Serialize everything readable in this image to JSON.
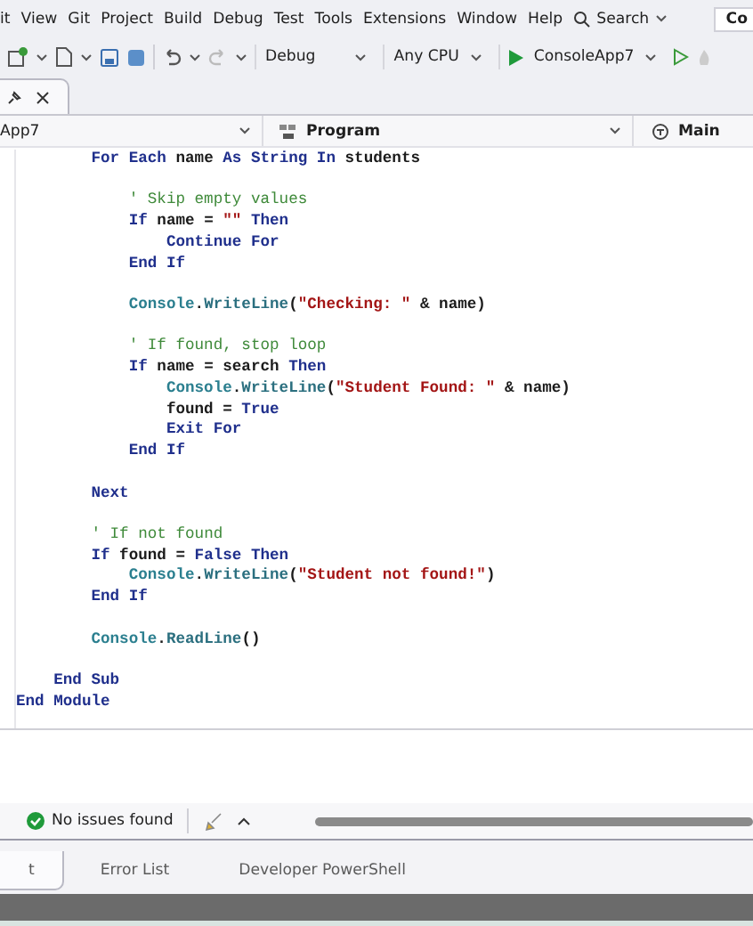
{
  "menu_bar": {
    "items": [
      "it",
      "View",
      "Git",
      "Project",
      "Build",
      "Debug",
      "Test",
      "Tools",
      "Extensions",
      "Window",
      "Help"
    ],
    "search": "Search",
    "account_badge": "Co"
  },
  "toolbar": {
    "configuration": "Debug",
    "platform": "Any CPU",
    "start_target": "ConsoleApp7"
  },
  "document_tab": {
    "selected": true
  },
  "navigation_bar": {
    "project": "App7",
    "class": "Program",
    "member": "Main"
  },
  "code_lines": [
    {
      "kind": "group",
      "children": [
        {
          "kind": "group",
          "children": [
            {
              "kind": "code",
              "tokens": [
                {
                  "kind": "keyword",
                  "text": "For Each"
                },
                {
                  "kind": "plain",
                  "text": " name "
                },
                {
                  "kind": "keyword",
                  "text": "As String In"
                },
                {
                  "kind": "plain",
                  "text": " students"
                }
              ],
              "children": [
                {
                  "kind": "blank"
                },
                {
                  "kind": "code",
                  "tokens": [
                    {
                      "kind": "comment",
                      "text": "' Skip empty values"
                    }
                  ]
                },
                {
                  "kind": "code",
                  "tokens": [
                    {
                      "kind": "keyword",
                      "text": "If"
                    },
                    {
                      "kind": "plain",
                      "text": " name = "
                    },
                    {
                      "kind": "string",
                      "text": "\"\""
                    },
                    {
                      "kind": "keyword",
                      "text": " Then"
                    }
                  ],
                  "children": [
                    {
                      "kind": "code",
                      "tokens": [
                        {
                          "kind": "keyword",
                          "text": "Continue For"
                        }
                      ]
                    }
                  ]
                },
                {
                  "kind": "code",
                  "tokens": [
                    {
                      "kind": "keyword",
                      "text": "End If"
                    }
                  ]
                },
                {
                  "kind": "blank"
                },
                {
                  "kind": "code",
                  "tokens": [
                    {
                      "kind": "type",
                      "text": "Console"
                    },
                    {
                      "kind": "plain",
                      "text": "."
                    },
                    {
                      "kind": "method",
                      "text": "WriteLine"
                    },
                    {
                      "kind": "plain",
                      "text": "("
                    },
                    {
                      "kind": "string",
                      "text": "\"Checking: \""
                    },
                    {
                      "kind": "plain",
                      "text": " & name)"
                    }
                  ]
                },
                {
                  "kind": "blank"
                },
                {
                  "kind": "code",
                  "tokens": [
                    {
                      "kind": "comment",
                      "text": "' If found, stop loop"
                    }
                  ]
                },
                {
                  "kind": "code",
                  "tokens": [
                    {
                      "kind": "keyword",
                      "text": "If"
                    },
                    {
                      "kind": "plain",
                      "text": " name = search "
                    },
                    {
                      "kind": "keyword",
                      "text": "Then"
                    }
                  ],
                  "children": [
                    {
                      "kind": "code",
                      "tokens": [
                        {
                          "kind": "type",
                          "text": "Console"
                        },
                        {
                          "kind": "plain",
                          "text": "."
                        },
                        {
                          "kind": "method",
                          "text": "WriteLine"
                        },
                        {
                          "kind": "plain",
                          "text": "("
                        },
                        {
                          "kind": "string",
                          "text": "\"Student Found: \""
                        },
                        {
                          "kind": "plain",
                          "text": " & name)"
                        }
                      ]
                    },
                    {
                      "kind": "code",
                      "tokens": [
                        {
                          "kind": "plain",
                          "text": "found = "
                        },
                        {
                          "kind": "keyword",
                          "text": "True"
                        }
                      ]
                    },
                    {
                      "kind": "code",
                      "tokens": [
                        {
                          "kind": "keyword",
                          "text": "Exit For"
                        }
                      ]
                    }
                  ]
                },
                {
                  "kind": "code",
                  "tokens": [
                    {
                      "kind": "keyword",
                      "text": "End If"
                    }
                  ]
                },
                {
                  "kind": "blank"
                }
              ]
            },
            {
              "kind": "code",
              "tokens": [
                {
                  "kind": "keyword",
                  "text": "Next"
                }
              ]
            },
            {
              "kind": "blank"
            },
            {
              "kind": "code",
              "tokens": [
                {
                  "kind": "comment",
                  "text": "' If not found"
                }
              ]
            },
            {
              "kind": "code",
              "tokens": [
                {
                  "kind": "keyword",
                  "text": "If"
                },
                {
                  "kind": "plain",
                  "text": " found = "
                },
                {
                  "kind": "keyword",
                  "text": "False Then"
                }
              ],
              "children": [
                {
                  "kind": "code",
                  "tokens": [
                    {
                      "kind": "type",
                      "text": "Console"
                    },
                    {
                      "kind": "plain",
                      "text": "."
                    },
                    {
                      "kind": "method",
                      "text": "WriteLine"
                    },
                    {
                      "kind": "plain",
                      "text": "("
                    },
                    {
                      "kind": "string",
                      "text": "\"Student not found!\""
                    },
                    {
                      "kind": "plain",
                      "text": ")"
                    }
                  ]
                }
              ]
            },
            {
              "kind": "code",
              "tokens": [
                {
                  "kind": "keyword",
                  "text": "End If"
                }
              ]
            },
            {
              "kind": "blank"
            },
            {
              "kind": "code",
              "tokens": [
                {
                  "kind": "type",
                  "text": "Console"
                },
                {
                  "kind": "plain",
                  "text": "."
                },
                {
                  "kind": "method",
                  "text": "ReadLine"
                },
                {
                  "kind": "plain",
                  "text": "()"
                }
              ]
            },
            {
              "kind": "blank"
            }
          ]
        },
        {
          "kind": "code",
          "tokens": [
            {
              "kind": "keyword",
              "text": "End Sub"
            }
          ]
        }
      ]
    },
    {
      "kind": "code",
      "tokens": [
        {
          "kind": "keyword",
          "text": "End Module"
        }
      ]
    }
  ],
  "status_bar": {
    "issues": "No issues found"
  },
  "bottom_tabs": [
    {
      "label": "t",
      "selected": true
    },
    {
      "label": "Error List",
      "selected": false
    },
    {
      "label": "Developer PowerShell",
      "selected": false
    }
  ]
}
